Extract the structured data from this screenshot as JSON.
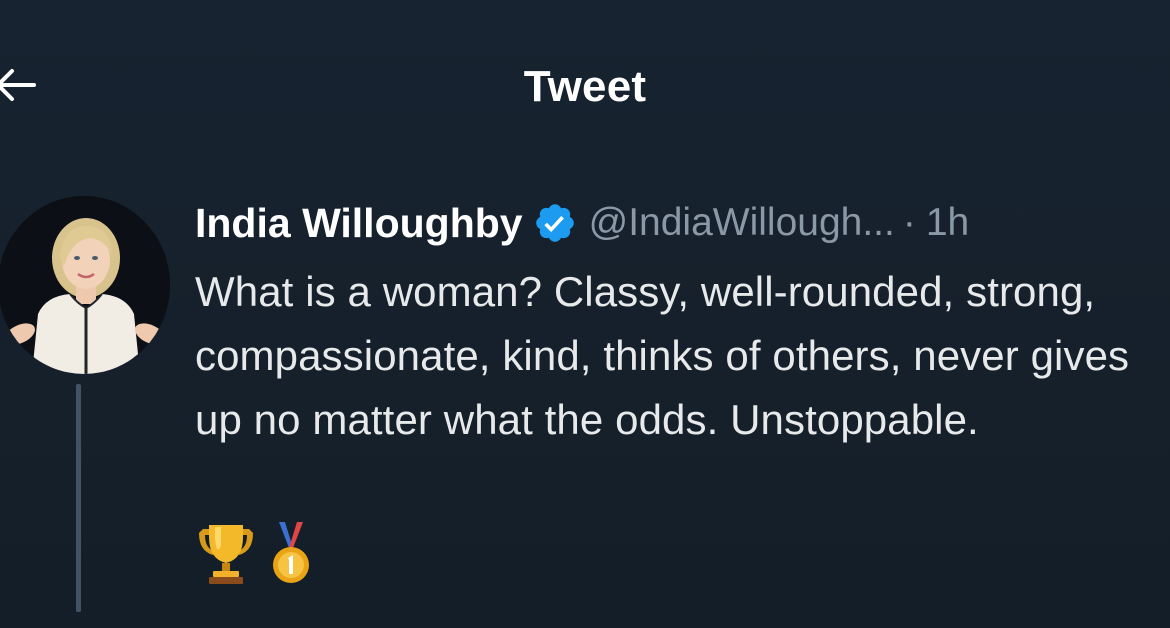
{
  "header": {
    "title": "Tweet",
    "back_icon": "arrow-left-icon"
  },
  "tweet": {
    "author": {
      "display_name": "India Willoughby",
      "handle": "@IndiaWillough...",
      "verified": true,
      "verified_icon": "verified-badge-icon"
    },
    "separator": "·",
    "timestamp": "1h",
    "text": "What is a woman? Classy, well-rounded, strong, compassionate, kind, thinks of others, never gives up no matter what the odds. Unstoppable.",
    "emojis": [
      "trophy-icon",
      "first-place-medal-icon"
    ]
  },
  "colors": {
    "background": "#15202b",
    "primary_text": "#e7e9ea",
    "secondary_text": "#8b98a5",
    "verified_blue": "#1d9bf0",
    "thread_line": "#425364"
  }
}
